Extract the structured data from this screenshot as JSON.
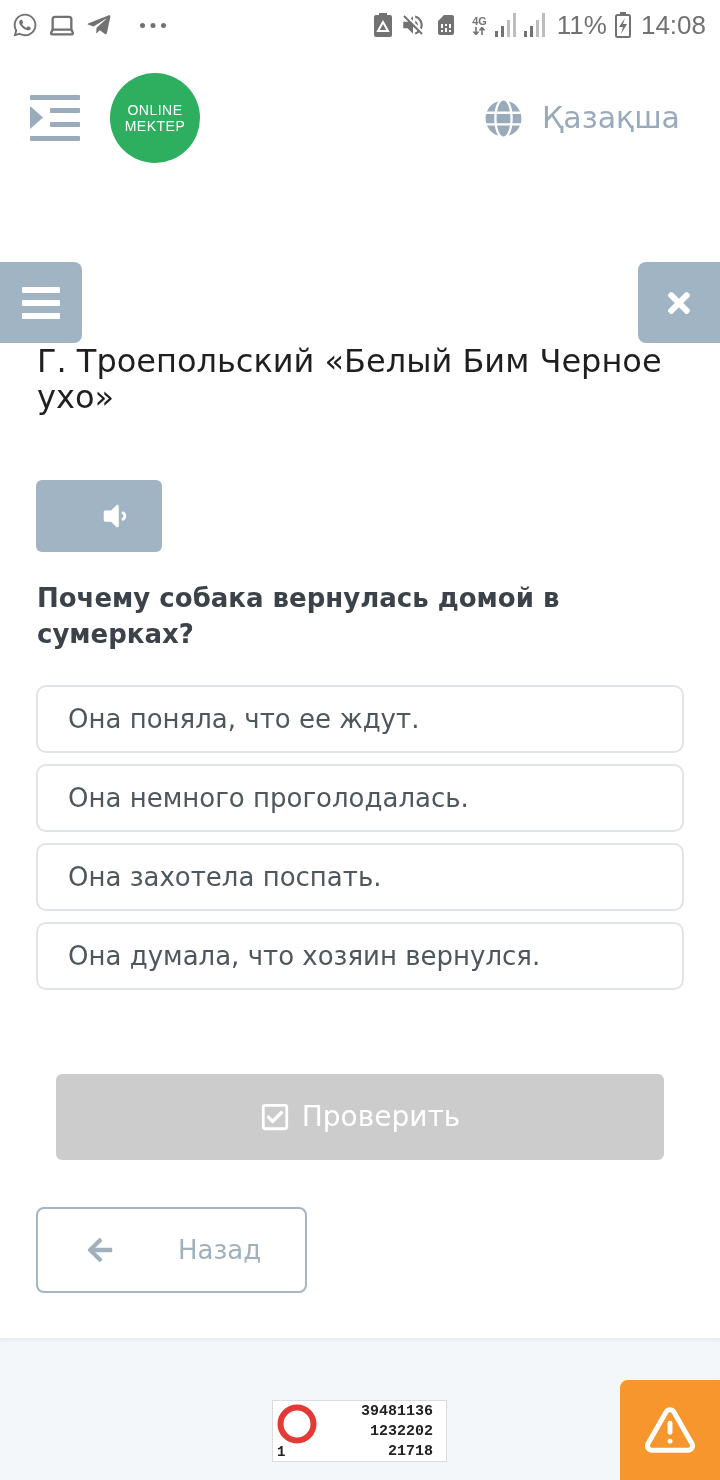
{
  "status_bar": {
    "network": "4G",
    "battery": "11%",
    "time": "14:08"
  },
  "header": {
    "logo": [
      "ONLINE",
      "MEKTEP"
    ],
    "language": "Қазақша"
  },
  "lesson": {
    "title": "Г. Троепольский «Белый Бим Черное ухо»",
    "question": "Почему собака вернулась домой в сумерках?",
    "options": [
      {
        "text": "Она поняла, что ее ждут.",
        "selected": false
      },
      {
        "text": "Она немного проголодалась.",
        "selected": false
      },
      {
        "text": "Она захотела поспать.",
        "selected": false
      },
      {
        "text": "Она думала, что хозяин вернулся.",
        "selected": false
      }
    ],
    "check_button": {
      "label": "Проверить",
      "disabled": true
    },
    "back_button": {
      "label": "Назад"
    }
  },
  "footer": {
    "counter": {
      "corner": "1",
      "values": [
        "39481136",
        "1232202",
        "21718"
      ]
    }
  }
}
